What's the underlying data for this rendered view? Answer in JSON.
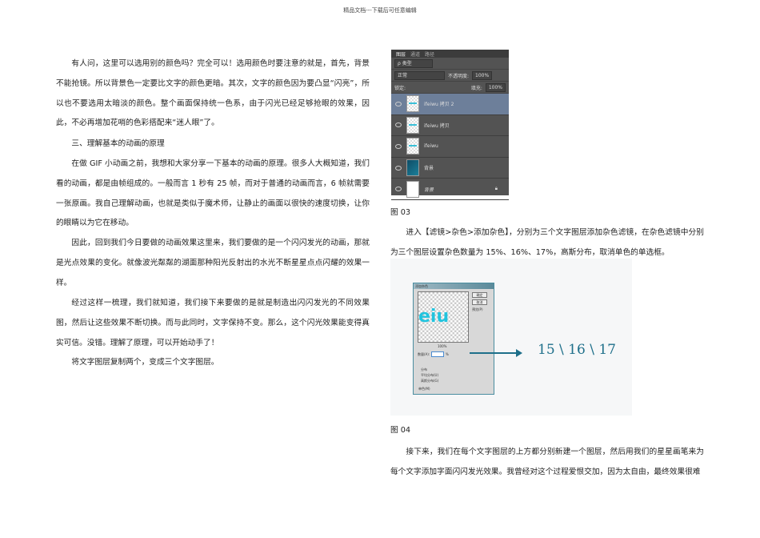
{
  "header": "精品文档---下载后可任意编辑",
  "left": {
    "p1": "有人问，这里可以选用别的颜色吗？完全可以！选用颜色时要注意的就是，首先，背景不能抢镜。所以背景色一定要比文字的颜色更暗。其次，文字的颜色因为要凸显“闪亮”，所以也不要选用太暗淡的颜色。整个画面保持统一色系，由于闪光已经足够抢眼的效果，因此，不必再增加花哨的色彩搭配来“迷人眼”了。",
    "heading": "三、理解基本的动画的原理",
    "p2": "在做 GIF 小动画之前，我想和大家分享一下基本的动画的原理。很多人大概知道，我们看的动画，都是由帧组成的。一般而言 1 秒有 25 帧，而对于普通的动画而言，6 帧就需要一张原画。我自己理解动画，也就是类似于魔术师，让静止的画面以很快的速度切换，让你的眼睛以为它在移动。",
    "p3": "因此，回到我们今日要做的动画效果这里来，我们要做的是一个闪闪发光的动画，那就是光点效果的变化。就像波光粼粼的湖面那种阳光反射出的水光不断星星点点闪耀的效果一样。",
    "p4": "经过这样一梳理，我们就知道，我们接下来要做的是就是制造出闪闪发光的不同效果图，然后让这些效果不断切换。而与此同时，文字保持不变。那么，这个闪光效果能变得真实可信。没错。理解了原理，可以开始动手了！",
    "p5": "将文字图层复制两个，变成三个文字图层。"
  },
  "layers_panel": {
    "tabs": [
      "图层",
      "通道",
      "路径"
    ],
    "filter": "ρ 类型",
    "blend_mode": "正常",
    "opacity_label": "不透明度:",
    "opacity": "100%",
    "lock_label": "锁定:",
    "fill_label": "填充:",
    "fill": "100%",
    "layers": [
      {
        "name": "ifeiwu 拷贝 2",
        "selected": true
      },
      {
        "name": "ifeiwu 拷贝"
      },
      {
        "name": "ifeiwu"
      },
      {
        "name": "背景"
      },
      {
        "name": "背景"
      }
    ]
  },
  "right": {
    "fig03": "图 03",
    "p1": "进入【滤镜>杂色>添加杂色】，分别为三个文字图层添加杂色滤镜，在杂色滤镜中分别为三个图层设置杂色数量为 15%、16%、17%，高斯分布，取消单色的单选框。",
    "fig04": "图 04",
    "p2": "接下来，我们在每个文字图层的上方都分别新建一个图层，然后用我们的星星画笔来为每个文字添加字面闪闪发光效果。我曾经对这个过程爱恨交加，因为太自由，最终效果很难"
  },
  "noise_dialog": {
    "title": "添加杂色",
    "preview_text": "eiu",
    "ok": "确定",
    "cancel": "取消",
    "preview": "预览(P)",
    "zoom": "100%",
    "amount_label": "数量(A):",
    "percent": "%",
    "distribution": "分布",
    "uniform": "平均分布(U)",
    "gaussian": "高斯分布(G)",
    "mono": "单色(M)"
  },
  "annotation": "15 \\ 16 \\ 17"
}
